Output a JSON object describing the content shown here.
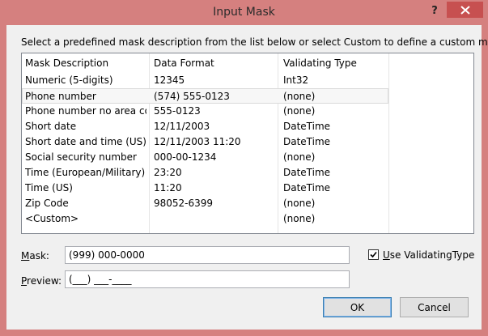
{
  "window": {
    "title": "Input Mask",
    "help_glyph": "?",
    "close_color": "#c75050"
  },
  "instruction": "Select a predefined mask description from the list below or select Custom to define a custom mask.",
  "list": {
    "headers": [
      "Mask Description",
      "Data Format",
      "Validating Type"
    ],
    "rows": [
      [
        "Numeric (5-digits)",
        "12345",
        "Int32"
      ],
      [
        "Phone number",
        "(574) 555-0123",
        "(none)"
      ],
      [
        "Phone number no area co...",
        "555-0123",
        "(none)"
      ],
      [
        "Short date",
        "12/11/2003",
        "DateTime"
      ],
      [
        "Short date and time (US)",
        "12/11/2003 11:20",
        "DateTime"
      ],
      [
        "Social security number",
        "000-00-1234",
        "(none)"
      ],
      [
        "Time (European/Military)",
        "23:20",
        "DateTime"
      ],
      [
        "Time (US)",
        "11:20",
        "DateTime"
      ],
      [
        "Zip Code",
        "98052-6399",
        "(none)"
      ],
      [
        "<Custom>",
        "",
        "(none)"
      ]
    ],
    "selected_index": 1
  },
  "mask": {
    "label_accel": "M",
    "label_rest": "ask:",
    "value": "(999) 000-0000"
  },
  "preview": {
    "label_accel": "P",
    "label_rest": "review:",
    "value": "(___) ___-____"
  },
  "validating_checkbox": {
    "checked": true,
    "label_accel": "U",
    "label_rest": "se ValidatingType"
  },
  "buttons": {
    "ok": "OK",
    "cancel": "Cancel"
  }
}
